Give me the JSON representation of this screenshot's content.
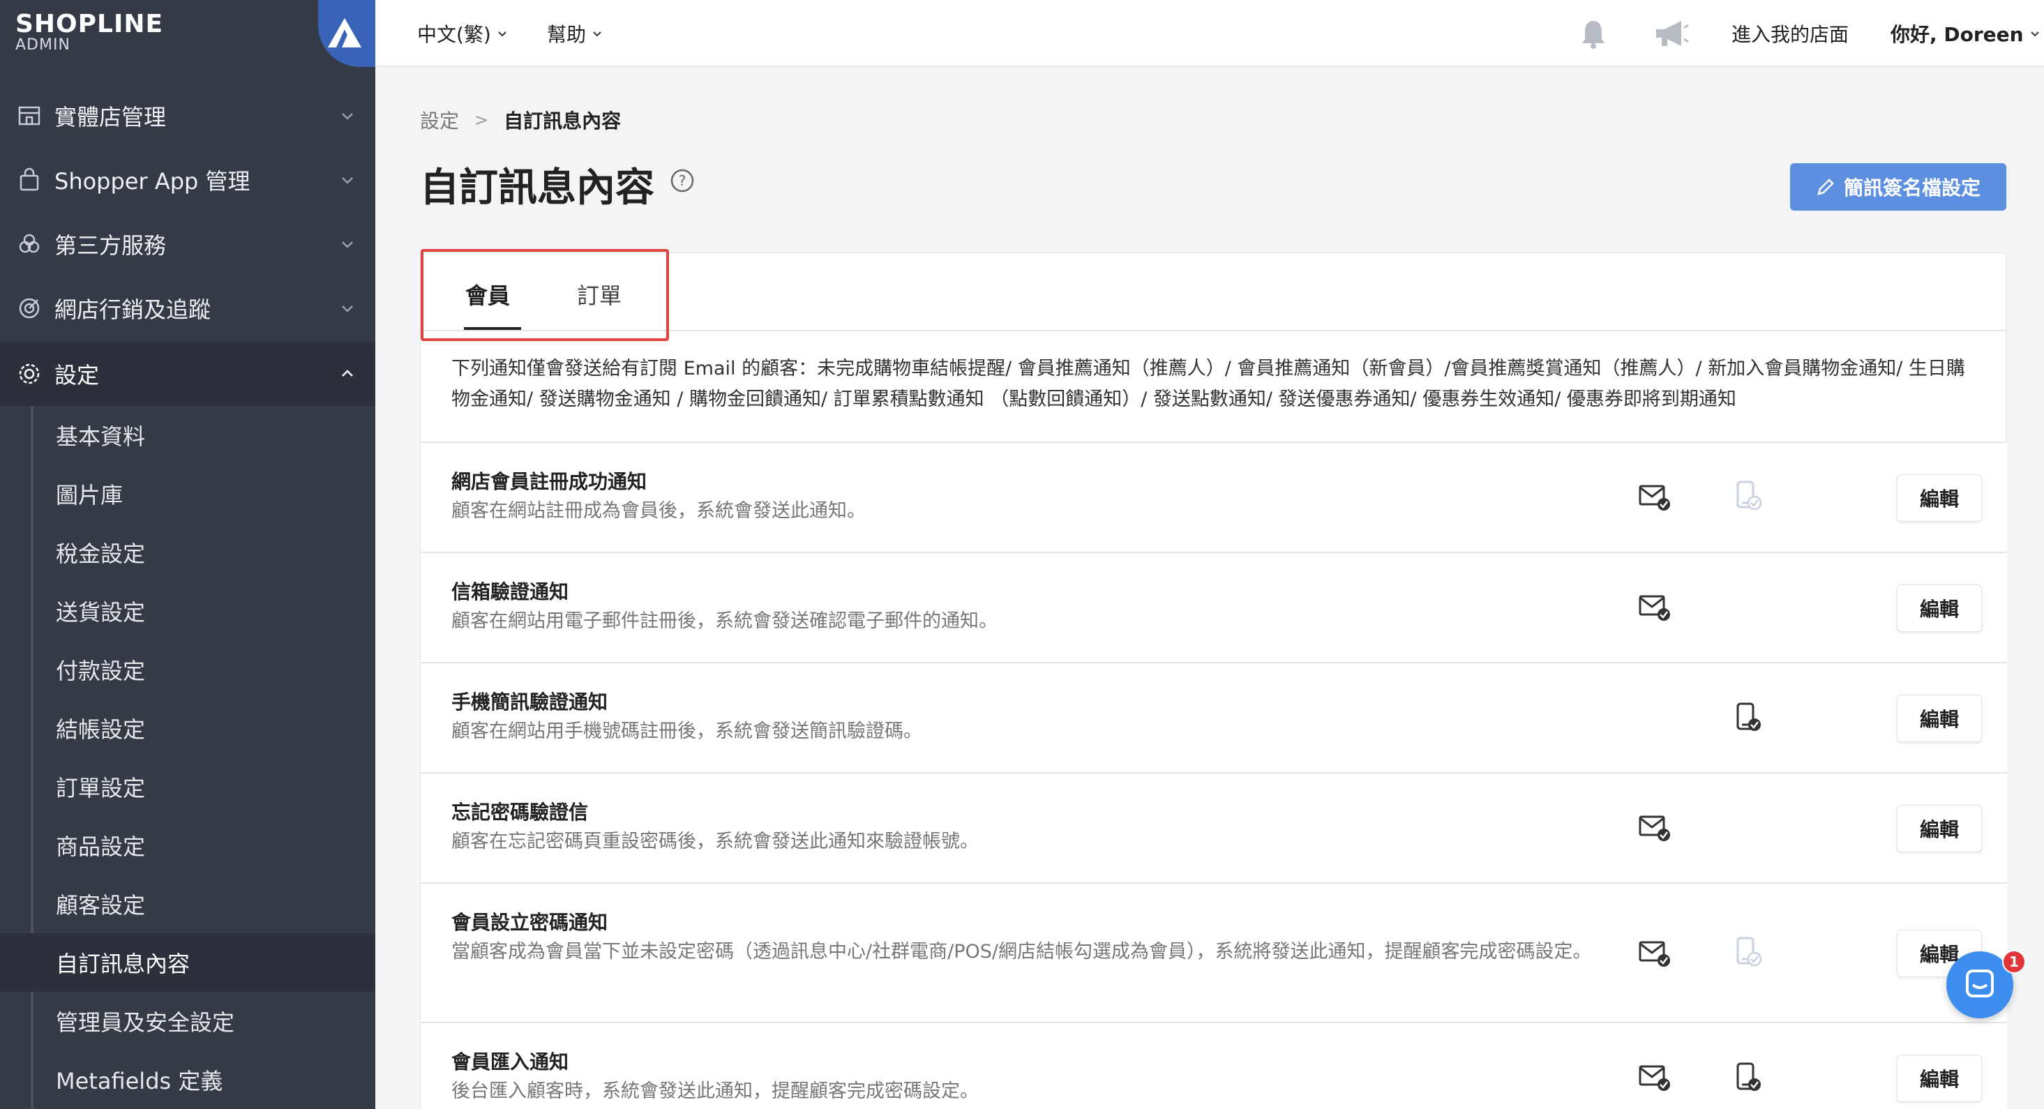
{
  "brand": {
    "logo": "SHOPLINE",
    "sub": "ADMIN"
  },
  "sidebar": {
    "groups": [
      {
        "label": "實體店管理",
        "icon": "store-icon"
      },
      {
        "label": "Shopper App 管理",
        "icon": "shopping-bag-icon"
      },
      {
        "label": "第三方服務",
        "icon": "apps-icon"
      },
      {
        "label": "網店行銷及追蹤",
        "icon": "target-icon"
      },
      {
        "label": "設定",
        "icon": "gear-icon"
      }
    ],
    "sub_items": [
      "基本資料",
      "圖片庫",
      "稅金設定",
      "送貨設定",
      "付款設定",
      "結帳設定",
      "訂單設定",
      "商品設定",
      "顧客設定",
      "自訂訊息內容",
      "管理員及安全設定",
      "Metafields 定義"
    ]
  },
  "header": {
    "language": "中文(繁)",
    "help": "幫助",
    "visit_store": "進入我的店面",
    "greeting": "你好, Doreen"
  },
  "breadcrumb": {
    "root": "設定",
    "sep": ">",
    "current": "自訂訊息內容"
  },
  "page": {
    "title": "自訂訊息內容",
    "sms_signature_button": "簡訊簽名檔設定"
  },
  "tabs": [
    {
      "label": "會員"
    },
    {
      "label": "訂單"
    }
  ],
  "info_text": "下列通知僅會發送給有訂閱 Email 的顧客：未完成購物車結帳提醒/ 會員推薦通知（推薦人）/ 會員推薦通知（新會員）/會員推薦獎賞通知（推薦人）/ 新加入會員購物金通知/ 生日購物金通知/ 發送購物金通知 / 購物金回饋通知/ 訂單累積點數通知 （點數回饋通知）/ 發送點數通知/ 發送優惠券通知/ 優惠券生效通知/ 優惠券即將到期通知",
  "rows": [
    {
      "title": "網店會員註冊成功通知",
      "desc": "顧客在網站註冊成為會員後，系統會發送此通知。",
      "email": "enabled",
      "sms": "disabled",
      "edit": "編輯"
    },
    {
      "title": "信箱驗證通知",
      "desc": "顧客在網站用電子郵件註冊後，系統會發送確認電子郵件的通知。",
      "email": "enabled",
      "sms": "none",
      "edit": "編輯"
    },
    {
      "title": "手機簡訊驗證通知",
      "desc": "顧客在網站用手機號碼註冊後，系統會發送簡訊驗證碼。",
      "email": "none",
      "sms": "enabled",
      "edit": "編輯"
    },
    {
      "title": "忘記密碼驗證信",
      "desc": "顧客在忘記密碼頁重設密碼後，系統會發送此通知來驗證帳號。",
      "email": "enabled",
      "sms": "none",
      "edit": "編輯"
    },
    {
      "title": "會員設立密碼通知",
      "desc": "當顧客成為會員當下並未設定密碼（透過訊息中心/社群電商/POS/網店結帳勾選成為會員），系統將發送此通知，提醒顧客完成密碼設定。",
      "email": "enabled",
      "sms": "disabled",
      "edit": "編輯"
    },
    {
      "title": "會員匯入通知",
      "desc": "後台匯入顧客時，系統會發送此通知，提醒顧客完成密碼設定。",
      "email": "enabled",
      "sms": "enabled",
      "edit": "編輯"
    }
  ],
  "chat": {
    "badge": "1"
  },
  "colors": {
    "sidebar": "#343a46",
    "accent": "#5d8fe0",
    "highlight": "#e0443c",
    "chat": "#3e8ef0"
  }
}
